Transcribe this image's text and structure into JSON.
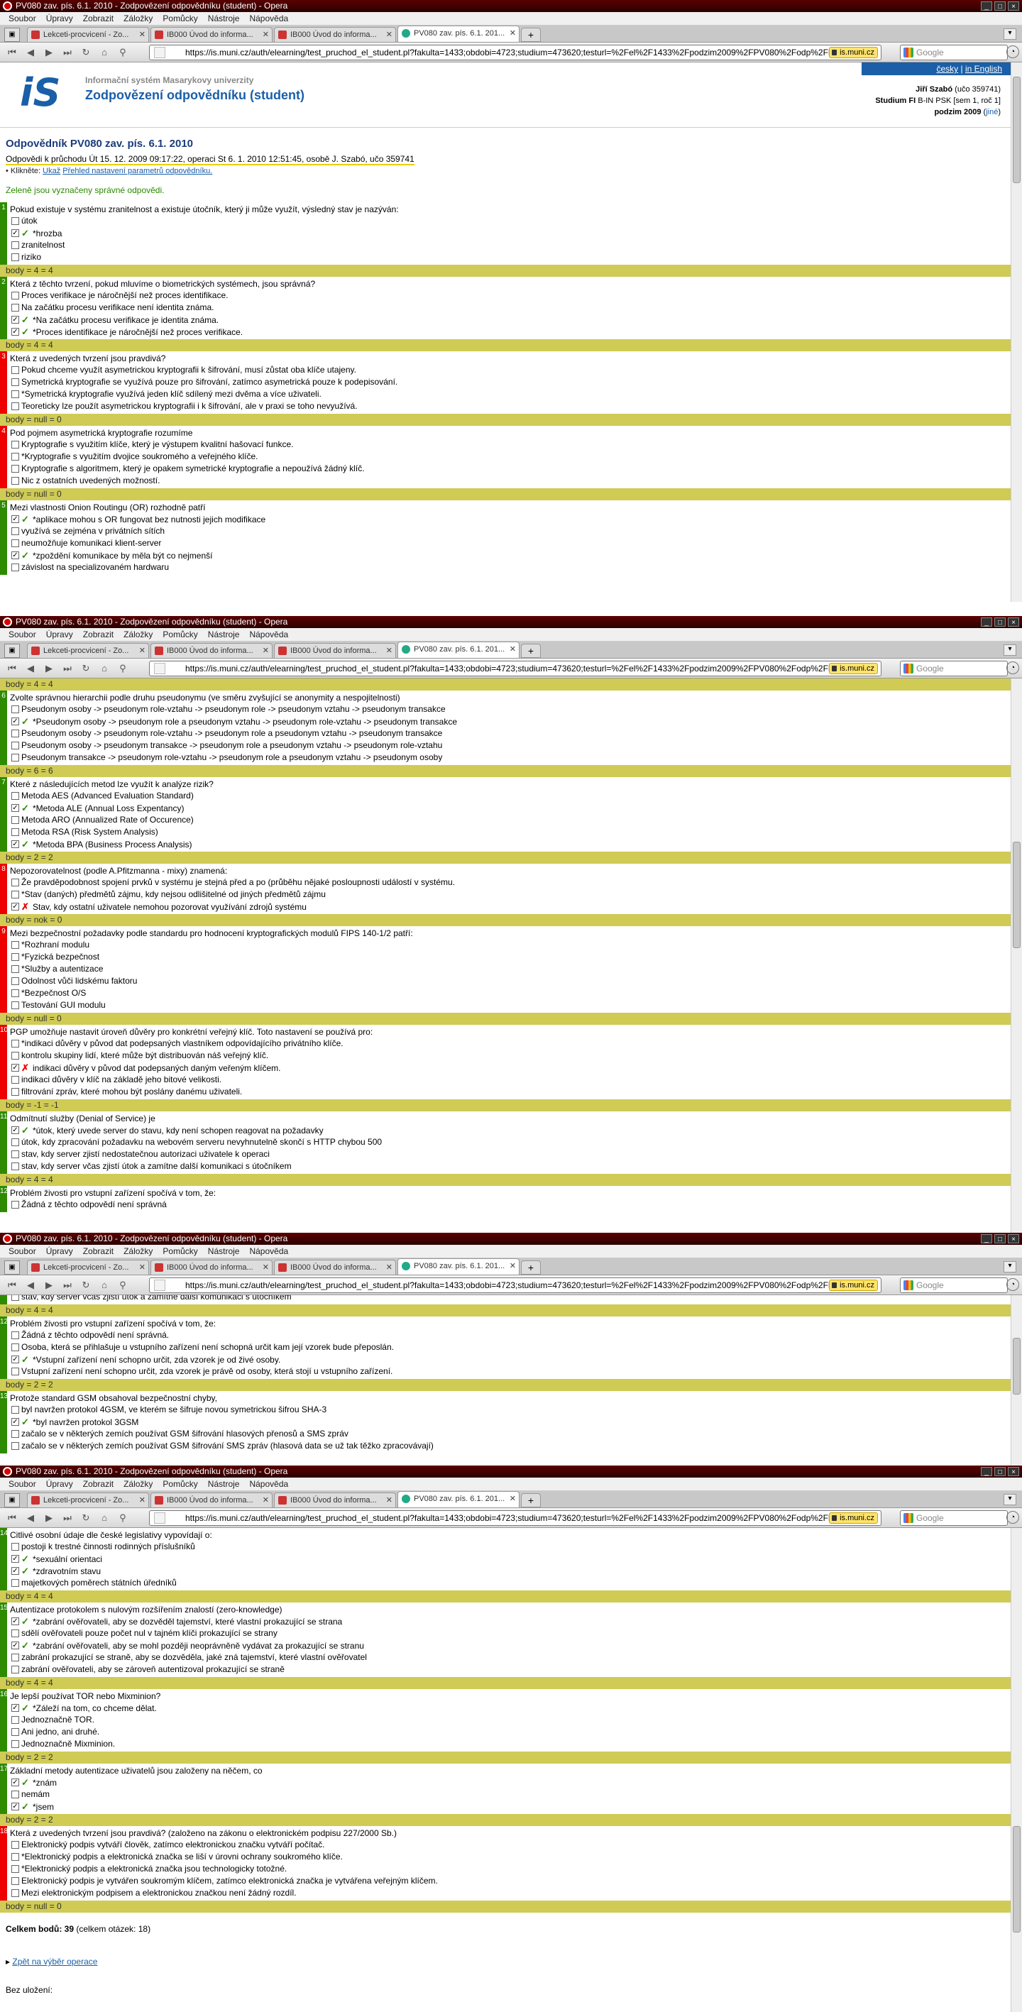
{
  "window_title": "PV080 zav. pís. 6.1. 2010 - Zodpovězení odpovědníku (student) - Opera",
  "menu": [
    "Soubor",
    "Úpravy",
    "Zobrazit",
    "Záložky",
    "Pomůcky",
    "Nástroje",
    "Nápověda"
  ],
  "tabs_a": [
    "Lekceti-procvicení - Zo...",
    "IB000 Úvod do informa...",
    "IB000 Úvod do informa...",
    "PV080 zav. pís. 6.1. 201..."
  ],
  "tabs_b": [
    "Lekceti-procvicení - Zo...",
    "IB000 Úvod do informa...",
    "IB000 Úvod do informa...",
    "PV080 zav. pís. 6.1. 201..."
  ],
  "url": "https://is.muni.cz/auth/elearning/test_pruchod_el_student.pl?fakulta=1433;obdobi=4723;studium=473620;testurl=%2Fel%2F1433%2Fpodzim2009%2FPV080%2Fodp%2FP",
  "site_badge": "is.muni.cz",
  "search_placeholder": "Google",
  "header": {
    "logo": "iS",
    "subtitle": "Informační systém Masarykovy univerzity",
    "title": "Zodpovězení odpovědníku (student)",
    "lang_cz": "česky",
    "lang_sep": " | ",
    "lang_en": "in English",
    "user_name": "Jiří Szabó",
    "user_uco": " (učo 359741)",
    "study_label": "Studium FI",
    "study_val": " B-IN PSK [sem 1, roč 1]",
    "term": "podzim 2009",
    "term_other": "jiné"
  },
  "heading": "Odpovědník PV080 zav. pís. 6.1. 2010",
  "meta": "Odpovědi k průchodu Út 15. 12. 2009 09:17:22, operaci St 6. 1. 2010 12:51:45, osobě J. Szabó, učo 359741",
  "hint_pre": "• Klikněte: ",
  "hint_link1": "Ukaž",
  "hint_link2": "Přehled nastavení parametrů odpovědníku.",
  "green_note": "Zeleně jsou vyznačeny správné odpovědi.",
  "questions_s1": [
    {
      "n": "1",
      "status": "g",
      "text": "Pokud existuje v systému zranitelnost a existuje útočník, který ji může využít, výsledný stav je nazýván:",
      "opts": [
        {
          "t": "útok",
          "c": false,
          "m": ""
        },
        {
          "t": "*hrozba",
          "c": true,
          "m": "ok"
        },
        {
          "t": "zranitelnost",
          "c": false,
          "m": ""
        },
        {
          "t": "riziko",
          "c": false,
          "m": ""
        }
      ],
      "score": "body = 4 = 4"
    },
    {
      "n": "2",
      "status": "g",
      "text": "Která z těchto tvrzení, pokud mluvíme o biometrických systémech, jsou správná?",
      "opts": [
        {
          "t": "Proces verifikace je náročnější než proces identifikace.",
          "c": false,
          "m": ""
        },
        {
          "t": "Na začátku procesu verifikace není identita známa.",
          "c": false,
          "m": ""
        },
        {
          "t": "*Na začátku procesu verifikace je identita známa.",
          "c": true,
          "m": "ok"
        },
        {
          "t": "*Proces identifikace je náročnější než proces verifikace.",
          "c": true,
          "m": "ok"
        }
      ],
      "score": "body = 4 = 4"
    },
    {
      "n": "3",
      "status": "r",
      "text": "Která z uvedených tvrzení jsou pravdivá?",
      "opts": [
        {
          "t": "Pokud chceme využít asymetrickou kryptografii k šifrování, musí zůstat oba klíče utajeny.",
          "c": false,
          "m": ""
        },
        {
          "t": "Symetrická kryptografie se využívá pouze pro šifrování, zatímco asymetrická pouze k podepisování.",
          "c": false,
          "m": ""
        },
        {
          "t": "*Symetrická kryptografie využívá jeden klíč sdílený mezi dvěma a více uživateli.",
          "c": false,
          "m": ""
        },
        {
          "t": "Teoreticky lze použít asymetrickou kryptografii i k šifrování, ale v praxi se toho nevyužívá.",
          "c": false,
          "m": ""
        }
      ],
      "score": "body = null = 0"
    },
    {
      "n": "4",
      "status": "r",
      "text": "Pod pojmem asymetrická kryptografie rozumíme",
      "opts": [
        {
          "t": "Kryptografie s využitím klíče, který je výstupem kvalitní hašovací funkce.",
          "c": false,
          "m": ""
        },
        {
          "t": "*Kryptografie s využitím dvojice soukromého a veřejného klíče.",
          "c": false,
          "m": ""
        },
        {
          "t": "Kryptografie s algoritmem, který je opakem symetrické kryptografie a nepoužívá žádný klíč.",
          "c": false,
          "m": ""
        },
        {
          "t": "Nic z ostatních uvedených možností.",
          "c": false,
          "m": ""
        }
      ],
      "score": "body = null = 0"
    },
    {
      "n": "5",
      "status": "g",
      "text": "Mezi vlastnosti Onion Routingu (OR) rozhodně patří",
      "opts": [
        {
          "t": "*aplikace mohou s OR fungovat bez nutnosti jejich modifikace",
          "c": true,
          "m": "ok"
        },
        {
          "t": "využívá se zejména v privátních sítích",
          "c": false,
          "m": ""
        },
        {
          "t": "neumožňuje komunikaci klient-server",
          "c": false,
          "m": ""
        },
        {
          "t": "*zpoždění komunikace by měla být co nejmenší",
          "c": true,
          "m": "ok"
        },
        {
          "t": "závislost na specializovaném hardwaru",
          "c": false,
          "m": ""
        }
      ],
      "score": ""
    }
  ],
  "s2_top_score": "body = 4 = 4",
  "questions_s2": [
    {
      "n": "6",
      "status": "g",
      "text": "Zvolte správnou hierarchii podle druhu pseudonymu (ve směru zvyšující se anonymity a nespojitelnosti)",
      "opts": [
        {
          "t": "Pseudonym osoby -> pseudonym role-vztahu -> pseudonym role -> pseudonym vztahu -> pseudonym transakce",
          "c": false,
          "m": ""
        },
        {
          "t": "*Pseudonym osoby -> pseudonym role a pseudonym vztahu -> pseudonym role-vztahu -> pseudonym transakce",
          "c": true,
          "m": "ok"
        },
        {
          "t": "Pseudonym osoby -> pseudonym role-vztahu -> pseudonym role a pseudonym vztahu -> pseudonym transakce",
          "c": false,
          "m": ""
        },
        {
          "t": "Pseudonym osoby -> pseudonym transakce -> pseudonym role a pseudonym vztahu -> pseudonym role-vztahu",
          "c": false,
          "m": ""
        },
        {
          "t": "Pseudonym transakce -> pseudonym role-vztahu -> pseudonym role a pseudonym vztahu -> pseudonym osoby",
          "c": false,
          "m": ""
        }
      ],
      "score": "body = 6 = 6"
    },
    {
      "n": "7",
      "status": "g",
      "text": "Které z následujících metod lze využít k analýze rizik?",
      "opts": [
        {
          "t": "Metoda AES (Advanced Evaluation Standard)",
          "c": false,
          "m": ""
        },
        {
          "t": "*Metoda ALE (Annual Loss Expentancy)",
          "c": true,
          "m": "ok"
        },
        {
          "t": "Metoda ARO (Annualized Rate of Occurence)",
          "c": false,
          "m": ""
        },
        {
          "t": "Metoda RSA (Risk System Analysis)",
          "c": false,
          "m": ""
        },
        {
          "t": "*Metoda BPA (Business Process Analysis)",
          "c": true,
          "m": "ok"
        }
      ],
      "score": "body = 2 = 2"
    },
    {
      "n": "8",
      "status": "r",
      "text": "Nepozorovatelnost (podle A.Pfitzmanna - mixy) znamená:",
      "opts": [
        {
          "t": "Že pravděpodobnost spojení prvků v systému je stejná před a po (průběhu nějaké posloupnosti událostí v systému.",
          "c": false,
          "m": ""
        },
        {
          "t": "*Stav (daných) předmětů zájmu, kdy nejsou odlišitelné od jiných předmětů zájmu",
          "c": false,
          "m": ""
        },
        {
          "t": "Stav, kdy ostatní uživatele nemohou pozorovat využívání zdrojů systému",
          "c": true,
          "m": "x"
        }
      ],
      "score": "body = nok = 0"
    },
    {
      "n": "9",
      "status": "r",
      "text": "Mezi bezpečnostní požadavky podle standardu pro hodnocení kryptografických modulů FIPS 140-1/2 patří:",
      "opts": [
        {
          "t": "*Rozhraní modulu",
          "c": false,
          "m": ""
        },
        {
          "t": "*Fyzická bezpečnost",
          "c": false,
          "m": ""
        },
        {
          "t": "*Služby a autentizace",
          "c": false,
          "m": ""
        },
        {
          "t": "Odolnost vůči lidskému faktoru",
          "c": false,
          "m": ""
        },
        {
          "t": "*Bezpečnost O/S",
          "c": false,
          "m": ""
        },
        {
          "t": "Testování GUI modulu",
          "c": false,
          "m": ""
        }
      ],
      "score": "body = null = 0"
    },
    {
      "n": "10",
      "status": "r",
      "text": "PGP umožňuje nastavit úroveň důvěry pro konkrétní veřejný klíč. Toto nastavení se používá pro:",
      "opts": [
        {
          "t": "*indikaci důvěry v původ dat podepsaných vlastníkem odpovídajícího privátního klíče.",
          "c": false,
          "m": ""
        },
        {
          "t": "kontrolu skupiny lidí, které může být distribuován náš veřejný klíč.",
          "c": false,
          "m": ""
        },
        {
          "t": "indikaci důvěry v původ dat podepsaných daným veřeným klíčem.",
          "c": true,
          "m": "x"
        },
        {
          "t": "indikaci důvěry v klíč na základě jeho bitové velikosti.",
          "c": false,
          "m": ""
        },
        {
          "t": "filtrování zpráv, které mohou být poslány danému uživateli.",
          "c": false,
          "m": ""
        }
      ],
      "score": "body = -1 = -1"
    },
    {
      "n": "11",
      "status": "g",
      "text": "Odmítnutí služby (Denial of Service) je",
      "opts": [
        {
          "t": "*útok, který uvede server do stavu, kdy není schopen reagovat na požadavky",
          "c": true,
          "m": "ok"
        },
        {
          "t": "útok, kdy zpracování požadavku na webovém serveru nevyhnutelně skončí s HTTP chybou 500",
          "c": false,
          "m": ""
        },
        {
          "t": "stav, kdy server zjistí nedostatečnou autorizaci uživatele k operaci",
          "c": false,
          "m": ""
        },
        {
          "t": "stav, kdy server včas zjistí útok a zamítne další komunikaci s útočníkem",
          "c": false,
          "m": ""
        }
      ],
      "score": "body = 4 = 4"
    },
    {
      "n": "12",
      "status": "g",
      "text": "Problém živosti pro vstupní zařízení spočívá v tom, že:",
      "opts": [
        {
          "t": "Žádná z těchto odpovědí není správná",
          "c": false,
          "m": ""
        }
      ],
      "score": ""
    }
  ],
  "s3_cut": "stav, kdy server včas zjistí útok a zamítne další komunikaci s útočníkem",
  "s3_top_score": "body = 4 = 4",
  "questions_s3": [
    {
      "n": "12",
      "status": "g",
      "text": "Problém živosti pro vstupní zařízení spočívá v tom, že:",
      "opts": [
        {
          "t": "Žádná z těchto odpovědí není správná.",
          "c": false,
          "m": ""
        },
        {
          "t": "Osoba, která se přihlašuje u vstupního zařízení není schopná určit kam její vzorek bude přeposlán.",
          "c": false,
          "m": ""
        },
        {
          "t": "*Vstupní zařízení není schopno určit, zda vzorek je od živé osoby.",
          "c": true,
          "m": "ok"
        },
        {
          "t": "Vstupní zařízení není schopno určit, zda vzorek je právě od osoby, která stojí u vstupního zařízení.",
          "c": false,
          "m": ""
        }
      ],
      "score": "body = 2 = 2"
    },
    {
      "n": "13",
      "status": "g",
      "text": "Protože standard GSM obsahoval bezpečnostní chyby,",
      "opts": [
        {
          "t": "byl navržen protokol 4GSM, ve kterém se šifruje novou symetrickou šifrou SHA-3",
          "c": false,
          "m": ""
        },
        {
          "t": "*byl navržen protokol 3GSM",
          "c": true,
          "m": "ok"
        },
        {
          "t": "začalo se v některých zemích používat GSM šifrování hlasových přenosů a SMS zpráv",
          "c": false,
          "m": ""
        },
        {
          "t": "začalo se v některých zemích používat GSM šifrování SMS zpráv (hlasová data se už tak těžko zpracovávají)",
          "c": false,
          "m": ""
        }
      ],
      "score": ""
    }
  ],
  "questions_s4": [
    {
      "n": "14",
      "status": "g",
      "text": "Citlivé osobní údaje dle české legislativy vypovídají o:",
      "opts": [
        {
          "t": "postoji k trestné činnosti rodinných příslušníků",
          "c": false,
          "m": ""
        },
        {
          "t": "*sexuální orientaci",
          "c": true,
          "m": "ok"
        },
        {
          "t": "*zdravotním stavu",
          "c": true,
          "m": "ok"
        },
        {
          "t": "majetkových poměrech státních úředníků",
          "c": false,
          "m": ""
        }
      ],
      "score": "body = 4 = 4"
    },
    {
      "n": "15",
      "status": "g",
      "text": "Autentizace protokolem s nulovým rozšířením znalostí (zero-knowledge)",
      "opts": [
        {
          "t": "*zabrání ověřovateli, aby se dozvěděl tajemství, které vlastní prokazující se strana",
          "c": true,
          "m": "ok"
        },
        {
          "t": "sdělí ověřovateli pouze počet nul v tajném klíči prokazující se strany",
          "c": false,
          "m": ""
        },
        {
          "t": "*zabrání ověřovateli, aby se mohl později neoprávněně vydávat za prokazující se stranu",
          "c": true,
          "m": "ok"
        },
        {
          "t": "zabrání prokazující se straně, aby se dozvěděla, jaké zná tajemství, které vlastní ověřovatel",
          "c": false,
          "m": ""
        },
        {
          "t": "zabrání ověřovateli, aby se zároveň autentizoval prokazující se straně",
          "c": false,
          "m": ""
        }
      ],
      "score": "body = 4 = 4"
    },
    {
      "n": "16",
      "status": "g",
      "text": "Je lepší používat TOR nebo Mixminion?",
      "opts": [
        {
          "t": "*Záleží na tom, co chceme dělat.",
          "c": true,
          "m": "ok"
        },
        {
          "t": "Jednoznačně TOR.",
          "c": false,
          "m": ""
        },
        {
          "t": "Ani jedno, ani druhé.",
          "c": false,
          "m": ""
        },
        {
          "t": "Jednoznačně Mixminion.",
          "c": false,
          "m": ""
        }
      ],
      "score": "body = 2 = 2"
    },
    {
      "n": "17",
      "status": "g",
      "text": "Základní metody autentizace uživatelů jsou založeny na něčem, co",
      "opts": [
        {
          "t": "*znám",
          "c": true,
          "m": "ok"
        },
        {
          "t": "nemám",
          "c": false,
          "m": ""
        },
        {
          "t": "*jsem",
          "c": true,
          "m": "ok"
        }
      ],
      "score": "body = 2 = 2"
    },
    {
      "n": "18",
      "status": "r",
      "text": "Která z uvedených tvrzení jsou pravdivá? (založeno na zákonu o elektronickém podpisu 227/2000 Sb.)",
      "opts": [
        {
          "t": "Elektronický podpis vytváří člověk, zatímco elektronickou značku vytváří počítač.",
          "c": false,
          "m": ""
        },
        {
          "t": "*Elektronický podpis a elektronická značka se liší v úrovni ochrany soukromého klíče.",
          "c": false,
          "m": ""
        },
        {
          "t": "*Elektronický podpis a elektronická značka jsou technologicky totožné.",
          "c": false,
          "m": ""
        },
        {
          "t": "Elektronický podpis je vytvářen soukromým klíčem, zatímco elektronická značka je vytvářena veřejným klíčem.",
          "c": false,
          "m": ""
        },
        {
          "t": "Mezi elektronickým podpisem a elektronickou značkou není žádný rozdíl.",
          "c": false,
          "m": ""
        }
      ],
      "score": "body = null = 0"
    }
  ],
  "total_label": "Celkem bodů:",
  "total_val": " 39",
  "total_rest": " (celkem otázek: 18)",
  "back_link": "Zpět na výběr operace",
  "saved": "Bez uložení:"
}
